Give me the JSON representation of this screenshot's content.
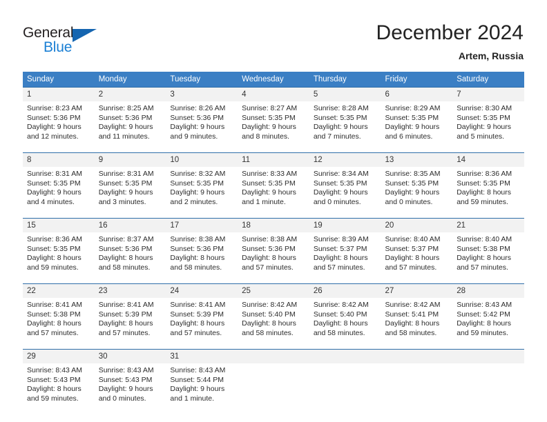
{
  "brand": {
    "name_top": "General",
    "name_bottom": "Blue",
    "triangle_color": "#1565b0",
    "blue_color": "#1a7fd4"
  },
  "header": {
    "title": "December 2024",
    "subtitle": "Artem, Russia"
  },
  "theme": {
    "header_bg": "#3b7fc4",
    "header_text": "#ffffff",
    "daynum_bg": "#f2f2f2",
    "row_divider": "#2e6da8",
    "body_text": "#2b2b2b"
  },
  "weekday_headers": [
    "Sunday",
    "Monday",
    "Tuesday",
    "Wednesday",
    "Thursday",
    "Friday",
    "Saturday"
  ],
  "weeks": [
    [
      {
        "day": "1",
        "sunrise": "Sunrise: 8:23 AM",
        "sunset": "Sunset: 5:36 PM",
        "daylight1": "Daylight: 9 hours",
        "daylight2": "and 12 minutes."
      },
      {
        "day": "2",
        "sunrise": "Sunrise: 8:25 AM",
        "sunset": "Sunset: 5:36 PM",
        "daylight1": "Daylight: 9 hours",
        "daylight2": "and 11 minutes."
      },
      {
        "day": "3",
        "sunrise": "Sunrise: 8:26 AM",
        "sunset": "Sunset: 5:36 PM",
        "daylight1": "Daylight: 9 hours",
        "daylight2": "and 9 minutes."
      },
      {
        "day": "4",
        "sunrise": "Sunrise: 8:27 AM",
        "sunset": "Sunset: 5:35 PM",
        "daylight1": "Daylight: 9 hours",
        "daylight2": "and 8 minutes."
      },
      {
        "day": "5",
        "sunrise": "Sunrise: 8:28 AM",
        "sunset": "Sunset: 5:35 PM",
        "daylight1": "Daylight: 9 hours",
        "daylight2": "and 7 minutes."
      },
      {
        "day": "6",
        "sunrise": "Sunrise: 8:29 AM",
        "sunset": "Sunset: 5:35 PM",
        "daylight1": "Daylight: 9 hours",
        "daylight2": "and 6 minutes."
      },
      {
        "day": "7",
        "sunrise": "Sunrise: 8:30 AM",
        "sunset": "Sunset: 5:35 PM",
        "daylight1": "Daylight: 9 hours",
        "daylight2": "and 5 minutes."
      }
    ],
    [
      {
        "day": "8",
        "sunrise": "Sunrise: 8:31 AM",
        "sunset": "Sunset: 5:35 PM",
        "daylight1": "Daylight: 9 hours",
        "daylight2": "and 4 minutes."
      },
      {
        "day": "9",
        "sunrise": "Sunrise: 8:31 AM",
        "sunset": "Sunset: 5:35 PM",
        "daylight1": "Daylight: 9 hours",
        "daylight2": "and 3 minutes."
      },
      {
        "day": "10",
        "sunrise": "Sunrise: 8:32 AM",
        "sunset": "Sunset: 5:35 PM",
        "daylight1": "Daylight: 9 hours",
        "daylight2": "and 2 minutes."
      },
      {
        "day": "11",
        "sunrise": "Sunrise: 8:33 AM",
        "sunset": "Sunset: 5:35 PM",
        "daylight1": "Daylight: 9 hours",
        "daylight2": "and 1 minute."
      },
      {
        "day": "12",
        "sunrise": "Sunrise: 8:34 AM",
        "sunset": "Sunset: 5:35 PM",
        "daylight1": "Daylight: 9 hours",
        "daylight2": "and 0 minutes."
      },
      {
        "day": "13",
        "sunrise": "Sunrise: 8:35 AM",
        "sunset": "Sunset: 5:35 PM",
        "daylight1": "Daylight: 9 hours",
        "daylight2": "and 0 minutes."
      },
      {
        "day": "14",
        "sunrise": "Sunrise: 8:36 AM",
        "sunset": "Sunset: 5:35 PM",
        "daylight1": "Daylight: 8 hours",
        "daylight2": "and 59 minutes."
      }
    ],
    [
      {
        "day": "15",
        "sunrise": "Sunrise: 8:36 AM",
        "sunset": "Sunset: 5:35 PM",
        "daylight1": "Daylight: 8 hours",
        "daylight2": "and 59 minutes."
      },
      {
        "day": "16",
        "sunrise": "Sunrise: 8:37 AM",
        "sunset": "Sunset: 5:36 PM",
        "daylight1": "Daylight: 8 hours",
        "daylight2": "and 58 minutes."
      },
      {
        "day": "17",
        "sunrise": "Sunrise: 8:38 AM",
        "sunset": "Sunset: 5:36 PM",
        "daylight1": "Daylight: 8 hours",
        "daylight2": "and 58 minutes."
      },
      {
        "day": "18",
        "sunrise": "Sunrise: 8:38 AM",
        "sunset": "Sunset: 5:36 PM",
        "daylight1": "Daylight: 8 hours",
        "daylight2": "and 57 minutes."
      },
      {
        "day": "19",
        "sunrise": "Sunrise: 8:39 AM",
        "sunset": "Sunset: 5:37 PM",
        "daylight1": "Daylight: 8 hours",
        "daylight2": "and 57 minutes."
      },
      {
        "day": "20",
        "sunrise": "Sunrise: 8:40 AM",
        "sunset": "Sunset: 5:37 PM",
        "daylight1": "Daylight: 8 hours",
        "daylight2": "and 57 minutes."
      },
      {
        "day": "21",
        "sunrise": "Sunrise: 8:40 AM",
        "sunset": "Sunset: 5:38 PM",
        "daylight1": "Daylight: 8 hours",
        "daylight2": "and 57 minutes."
      }
    ],
    [
      {
        "day": "22",
        "sunrise": "Sunrise: 8:41 AM",
        "sunset": "Sunset: 5:38 PM",
        "daylight1": "Daylight: 8 hours",
        "daylight2": "and 57 minutes."
      },
      {
        "day": "23",
        "sunrise": "Sunrise: 8:41 AM",
        "sunset": "Sunset: 5:39 PM",
        "daylight1": "Daylight: 8 hours",
        "daylight2": "and 57 minutes."
      },
      {
        "day": "24",
        "sunrise": "Sunrise: 8:41 AM",
        "sunset": "Sunset: 5:39 PM",
        "daylight1": "Daylight: 8 hours",
        "daylight2": "and 57 minutes."
      },
      {
        "day": "25",
        "sunrise": "Sunrise: 8:42 AM",
        "sunset": "Sunset: 5:40 PM",
        "daylight1": "Daylight: 8 hours",
        "daylight2": "and 58 minutes."
      },
      {
        "day": "26",
        "sunrise": "Sunrise: 8:42 AM",
        "sunset": "Sunset: 5:40 PM",
        "daylight1": "Daylight: 8 hours",
        "daylight2": "and 58 minutes."
      },
      {
        "day": "27",
        "sunrise": "Sunrise: 8:42 AM",
        "sunset": "Sunset: 5:41 PM",
        "daylight1": "Daylight: 8 hours",
        "daylight2": "and 58 minutes."
      },
      {
        "day": "28",
        "sunrise": "Sunrise: 8:43 AM",
        "sunset": "Sunset: 5:42 PM",
        "daylight1": "Daylight: 8 hours",
        "daylight2": "and 59 minutes."
      }
    ],
    [
      {
        "day": "29",
        "sunrise": "Sunrise: 8:43 AM",
        "sunset": "Sunset: 5:43 PM",
        "daylight1": "Daylight: 8 hours",
        "daylight2": "and 59 minutes."
      },
      {
        "day": "30",
        "sunrise": "Sunrise: 8:43 AM",
        "sunset": "Sunset: 5:43 PM",
        "daylight1": "Daylight: 9 hours",
        "daylight2": "and 0 minutes."
      },
      {
        "day": "31",
        "sunrise": "Sunrise: 8:43 AM",
        "sunset": "Sunset: 5:44 PM",
        "daylight1": "Daylight: 9 hours",
        "daylight2": "and 1 minute."
      },
      {
        "day": "",
        "sunrise": "",
        "sunset": "",
        "daylight1": "",
        "daylight2": ""
      },
      {
        "day": "",
        "sunrise": "",
        "sunset": "",
        "daylight1": "",
        "daylight2": ""
      },
      {
        "day": "",
        "sunrise": "",
        "sunset": "",
        "daylight1": "",
        "daylight2": ""
      },
      {
        "day": "",
        "sunrise": "",
        "sunset": "",
        "daylight1": "",
        "daylight2": ""
      }
    ]
  ]
}
